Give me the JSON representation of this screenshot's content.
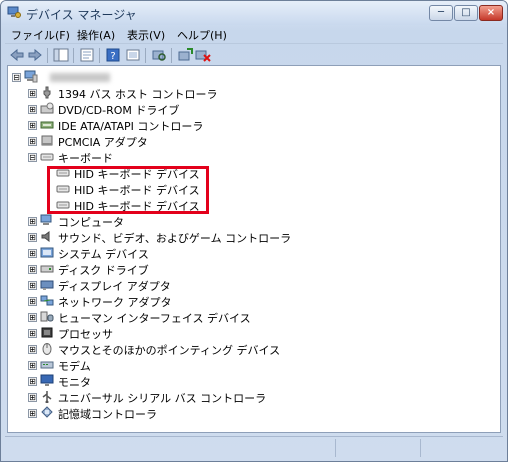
{
  "window": {
    "title": "デバイス マネージャ"
  },
  "titlebar_buttons": {
    "minimize": "─",
    "maximize": "□",
    "close": "×"
  },
  "menu": [
    "ファイル(F)",
    "操作(A)",
    "表示(V)",
    "ヘルプ(H)"
  ],
  "toolbar_icons": [
    "back-icon",
    "forward-icon",
    "show-hide-tree-icon",
    "properties-icon",
    "help-icon",
    "show-hidden-devices-icon",
    "update-driver-icon",
    "uninstall-device-icon"
  ],
  "tree": {
    "root": {
      "expander": "⊟",
      "label": ""
    },
    "items": [
      {
        "label": "1394 バス ホスト コントローラ",
        "expander": "⊞",
        "icon": "plug-icon"
      },
      {
        "label": "DVD/CD-ROM ドライブ",
        "expander": "⊞",
        "icon": "dvd-drive-icon"
      },
      {
        "label": "IDE ATA/ATAPI コントローラ",
        "expander": "⊞",
        "icon": "ide-controller-icon"
      },
      {
        "label": "PCMCIA アダプタ",
        "expander": "⊞",
        "icon": "pcmcia-icon"
      },
      {
        "label": "キーボード",
        "expander": "⊟",
        "icon": "keyboard-icon"
      },
      {
        "label": "HID キーボード デバイス",
        "expander": "",
        "icon": "keyboard-icon",
        "child": true
      },
      {
        "label": "HID キーボード デバイス",
        "expander": "",
        "icon": "keyboard-icon",
        "child": true
      },
      {
        "label": "HID キーボード デバイス",
        "expander": "",
        "icon": "keyboard-icon",
        "child": true
      },
      {
        "label": "コンピュータ",
        "expander": "⊞",
        "icon": "computer-icon"
      },
      {
        "label": "サウンド、ビデオ、およびゲーム コントローラ",
        "expander": "⊞",
        "icon": "speaker-icon"
      },
      {
        "label": "システム デバイス",
        "expander": "⊞",
        "icon": "system-device-icon"
      },
      {
        "label": "ディスク ドライブ",
        "expander": "⊞",
        "icon": "disk-drive-icon"
      },
      {
        "label": "ディスプレイ アダプタ",
        "expander": "⊞",
        "icon": "display-adapter-icon"
      },
      {
        "label": "ネットワーク アダプタ",
        "expander": "⊞",
        "icon": "network-adapter-icon"
      },
      {
        "label": "ヒューマン インターフェイス デバイス",
        "expander": "⊞",
        "icon": "hid-icon"
      },
      {
        "label": "プロセッサ",
        "expander": "⊞",
        "icon": "processor-icon"
      },
      {
        "label": "マウスとそのほかのポインティング デバイス",
        "expander": "⊞",
        "icon": "mouse-icon"
      },
      {
        "label": "モデム",
        "expander": "⊞",
        "icon": "modem-icon"
      },
      {
        "label": "モニタ",
        "expander": "⊞",
        "icon": "monitor-icon"
      },
      {
        "label": "ユニバーサル シリアル バス コントローラ",
        "expander": "⊞",
        "icon": "usb-icon"
      },
      {
        "label": "記憶域コントローラ",
        "expander": "⊞",
        "icon": "storage-controller-icon"
      }
    ]
  },
  "colors": {
    "highlight": "#e3001b",
    "title_text": "#1e395b"
  }
}
